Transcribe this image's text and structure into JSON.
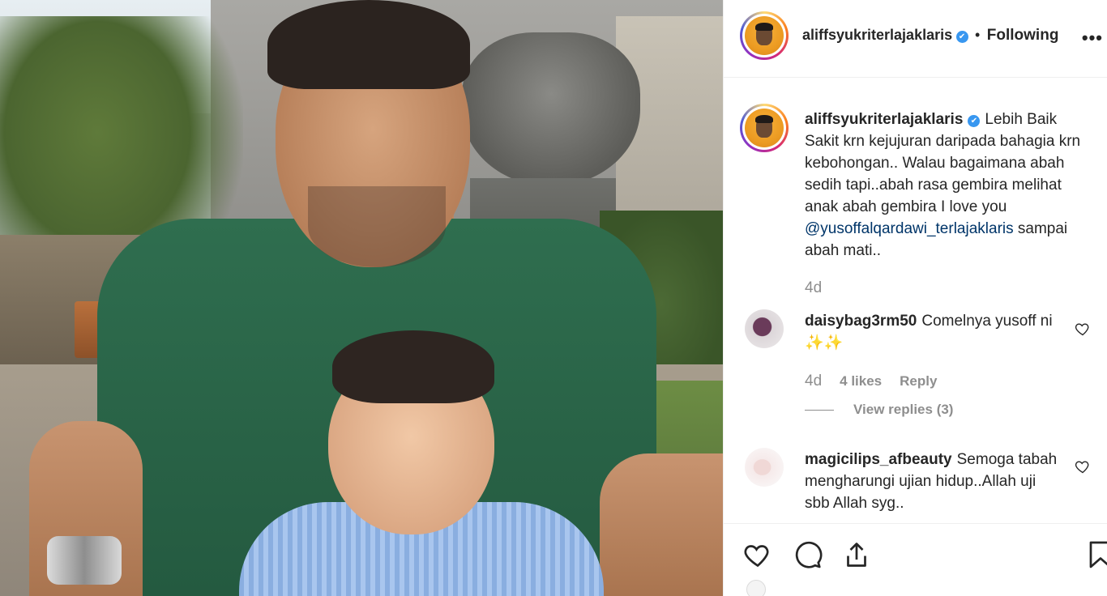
{
  "post": {
    "photo_alt": "",
    "header": {
      "username": "aliffsyukriterlajaklaris",
      "verified_glyph": "✔",
      "separator": "•",
      "follow_status": "Following",
      "more_icon": "•••"
    },
    "caption": {
      "username": "aliffsyukriterlajaklaris",
      "text_before_mention": "Lebih Baik Sakit krn kejujuran daripada bahagia krn kebohongan.. Walau bagaimana abah sedih tapi..abah rasa gembira melihat anak abah gembira I love you",
      "mention": "@yusoffalqardawi_terlajaklaris",
      "text_after_mention": " sampai abah mati..",
      "time": "4d"
    },
    "comments": [
      {
        "username": "daisybag3rm50",
        "text": "Comelnya yusoff ni ✨✨",
        "time": "4d",
        "likes": "4 likes",
        "reply": "Reply",
        "view_replies": "View replies (3)"
      },
      {
        "username": "magicilips_afbeauty",
        "text": "Semoga tabah mengharungi ujian hidup..Allah uji sbb Allah syg.."
      }
    ],
    "actions": {
      "like_icon": "heart-icon",
      "comment_icon": "comment-icon",
      "share_icon": "share-icon",
      "save_icon": "bookmark-icon"
    }
  },
  "colors": {
    "text": "#262626",
    "muted": "#8e8e8e",
    "mention": "#003569",
    "verified": "#3897f0",
    "border": "#efefef"
  }
}
